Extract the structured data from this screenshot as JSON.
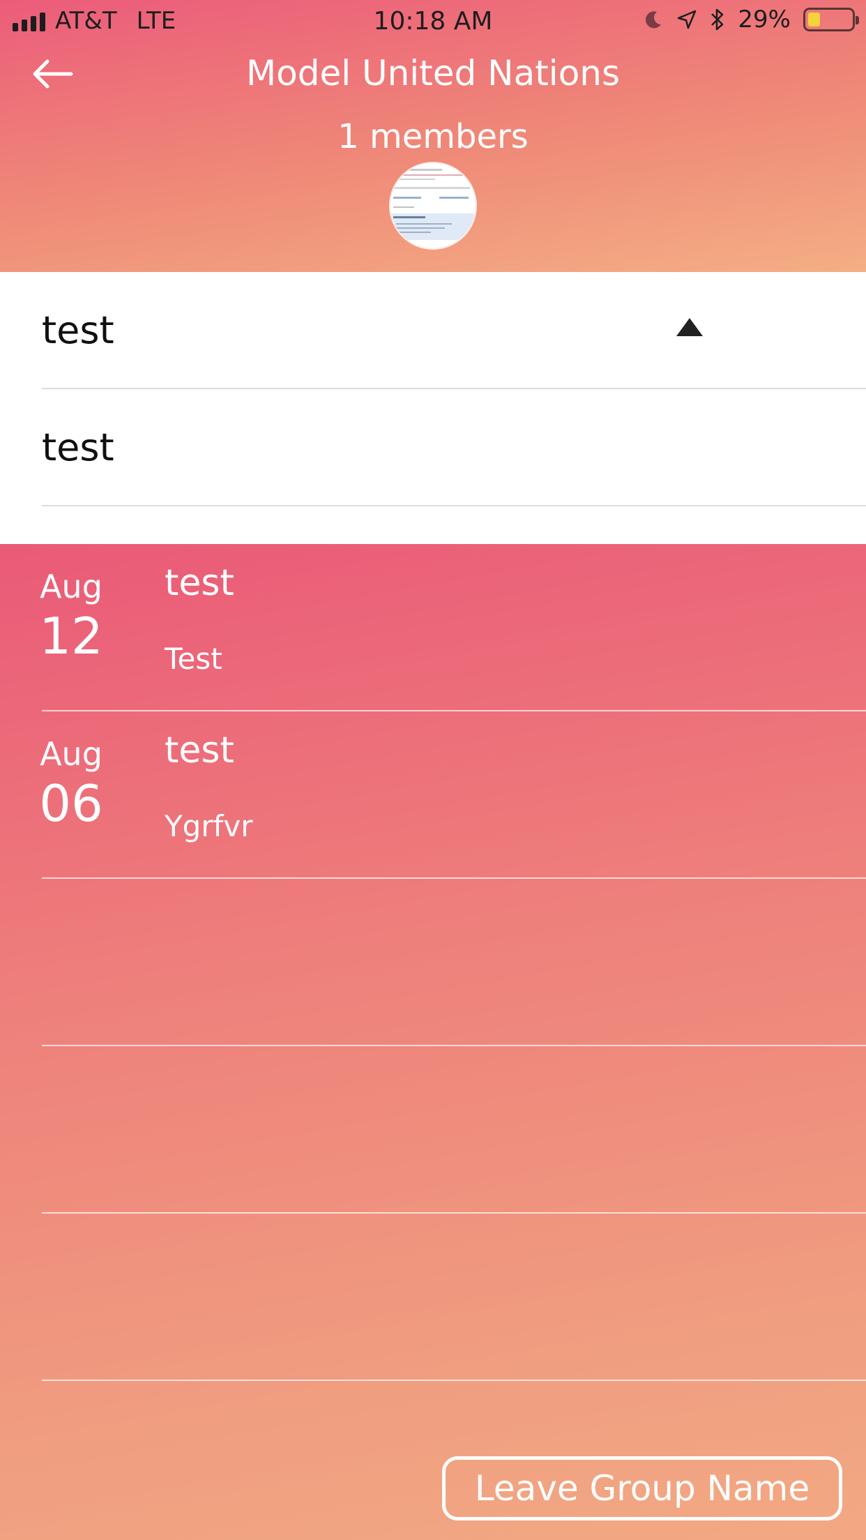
{
  "status_bar": {
    "carrier": "AT&T",
    "network": "LTE",
    "time": "10:18 AM",
    "battery_percent": "29%",
    "battery_level": 0.29,
    "icons": [
      "moon-icon",
      "location-icon",
      "bluetooth-icon",
      "battery-icon"
    ]
  },
  "header": {
    "title": "Model United Nations",
    "members": "1 members"
  },
  "topics": [
    {
      "label": "test"
    },
    {
      "label": "test"
    }
  ],
  "events": [
    {
      "month": "Aug",
      "day": "12",
      "title": "test",
      "description": "Test"
    },
    {
      "month": "Aug",
      "day": "06",
      "title": "test",
      "description": "Ygrfvr"
    }
  ],
  "footer": {
    "leave_label": "Leave Group Name"
  },
  "colors": {
    "gradient_top": "#ec5c7a",
    "gradient_bottom": "#f4ae84",
    "battery_fill": "#f7d23c"
  }
}
